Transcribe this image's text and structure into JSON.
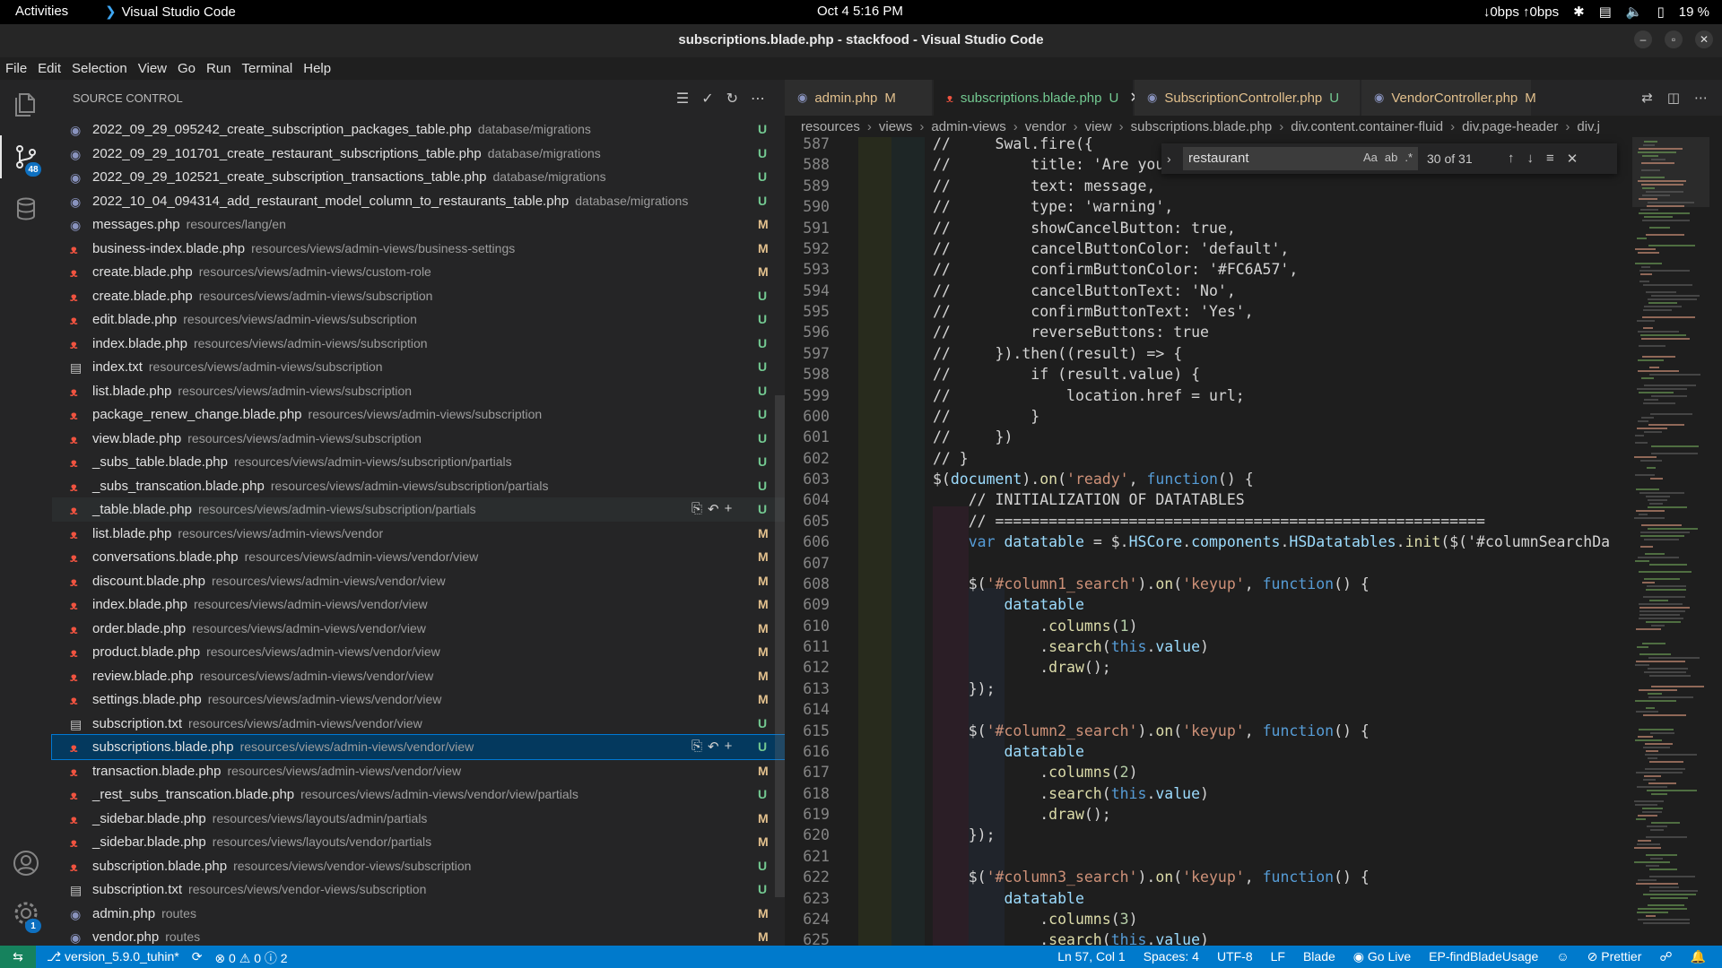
{
  "topbar": {
    "activities": "Activities",
    "app_name": "Visual Studio Code",
    "clock": "Oct 4  5:16 PM",
    "network": "↓0bps ↑0bps",
    "battery": "19 %"
  },
  "window": {
    "title": "subscriptions.blade.php - stackfood - Visual Studio Code"
  },
  "menu": [
    "File",
    "Edit",
    "Selection",
    "View",
    "Go",
    "Run",
    "Terminal",
    "Help"
  ],
  "activity": {
    "source_control_badge": "48",
    "settings_badge": "1"
  },
  "sidebar": {
    "title": "SOURCE CONTROL",
    "files": [
      {
        "name": "2022_09_29_095242_create_subscription_packages_table.php",
        "path": "database/migrations",
        "status": "U",
        "icon": "php"
      },
      {
        "name": "2022_09_29_101701_create_restaurant_subscriptions_table.php",
        "path": "database/migrations",
        "status": "U",
        "icon": "php"
      },
      {
        "name": "2022_09_29_102521_create_subscription_transactions_table.php",
        "path": "database/migrations",
        "status": "U",
        "icon": "php"
      },
      {
        "name": "2022_10_04_094314_add_restaurant_model_column_to_restaurants_table.php",
        "path": "database/migrations",
        "status": "U",
        "icon": "php"
      },
      {
        "name": "messages.php",
        "path": "resources/lang/en",
        "status": "M",
        "icon": "php"
      },
      {
        "name": "business-index.blade.php",
        "path": "resources/views/admin-views/business-settings",
        "status": "M",
        "icon": "blade"
      },
      {
        "name": "create.blade.php",
        "path": "resources/views/admin-views/custom-role",
        "status": "M",
        "icon": "blade"
      },
      {
        "name": "create.blade.php",
        "path": "resources/views/admin-views/subscription",
        "status": "U",
        "icon": "blade"
      },
      {
        "name": "edit.blade.php",
        "path": "resources/views/admin-views/subscription",
        "status": "U",
        "icon": "blade"
      },
      {
        "name": "index.blade.php",
        "path": "resources/views/admin-views/subscription",
        "status": "U",
        "icon": "blade"
      },
      {
        "name": "index.txt",
        "path": "resources/views/admin-views/subscription",
        "status": "U",
        "icon": "txt"
      },
      {
        "name": "list.blade.php",
        "path": "resources/views/admin-views/subscription",
        "status": "U",
        "icon": "blade"
      },
      {
        "name": "package_renew_change.blade.php",
        "path": "resources/views/admin-views/subscription",
        "status": "U",
        "icon": "blade"
      },
      {
        "name": "view.blade.php",
        "path": "resources/views/admin-views/subscription",
        "status": "U",
        "icon": "blade"
      },
      {
        "name": "_subs_table.blade.php",
        "path": "resources/views/admin-views/subscription/partials",
        "status": "U",
        "icon": "blade"
      },
      {
        "name": "_subs_transcation.blade.php",
        "path": "resources/views/admin-views/subscription/partials",
        "status": "U",
        "icon": "blade"
      },
      {
        "name": "_table.blade.php",
        "path": "resources/views/admin-views/subscription/partials",
        "status": "U",
        "icon": "blade",
        "hover": true
      },
      {
        "name": "list.blade.php",
        "path": "resources/views/admin-views/vendor",
        "status": "M",
        "icon": "blade"
      },
      {
        "name": "conversations.blade.php",
        "path": "resources/views/admin-views/vendor/view",
        "status": "M",
        "icon": "blade"
      },
      {
        "name": "discount.blade.php",
        "path": "resources/views/admin-views/vendor/view",
        "status": "M",
        "icon": "blade"
      },
      {
        "name": "index.blade.php",
        "path": "resources/views/admin-views/vendor/view",
        "status": "M",
        "icon": "blade"
      },
      {
        "name": "order.blade.php",
        "path": "resources/views/admin-views/vendor/view",
        "status": "M",
        "icon": "blade"
      },
      {
        "name": "product.blade.php",
        "path": "resources/views/admin-views/vendor/view",
        "status": "M",
        "icon": "blade"
      },
      {
        "name": "review.blade.php",
        "path": "resources/views/admin-views/vendor/view",
        "status": "M",
        "icon": "blade"
      },
      {
        "name": "settings.blade.php",
        "path": "resources/views/admin-views/vendor/view",
        "status": "M",
        "icon": "blade"
      },
      {
        "name": "subscription.txt",
        "path": "resources/views/admin-views/vendor/view",
        "status": "U",
        "icon": "txt"
      },
      {
        "name": "subscriptions.blade.php",
        "path": "resources/views/admin-views/vendor/view",
        "status": "U",
        "icon": "blade",
        "selected": true
      },
      {
        "name": "transaction.blade.php",
        "path": "resources/views/admin-views/vendor/view",
        "status": "M",
        "icon": "blade"
      },
      {
        "name": "_rest_subs_transcation.blade.php",
        "path": "resources/views/admin-views/vendor/view/partials",
        "status": "U",
        "icon": "blade"
      },
      {
        "name": "_sidebar.blade.php",
        "path": "resources/views/layouts/admin/partials",
        "status": "M",
        "icon": "blade"
      },
      {
        "name": "_sidebar.blade.php",
        "path": "resources/views/layouts/vendor/partials",
        "status": "M",
        "icon": "blade"
      },
      {
        "name": "subscription.blade.php",
        "path": "resources/views/vendor-views/subscription",
        "status": "U",
        "icon": "blade"
      },
      {
        "name": "subscription.txt",
        "path": "resources/views/vendor-views/subscription",
        "status": "U",
        "icon": "txt"
      },
      {
        "name": "admin.php",
        "path": "routes",
        "status": "M",
        "icon": "php"
      },
      {
        "name": "vendor.php",
        "path": "routes",
        "status": "M",
        "icon": "php"
      }
    ]
  },
  "tabs": [
    {
      "label": "admin.php",
      "status": "M",
      "icon": "php",
      "active": false
    },
    {
      "label": "subscriptions.blade.php",
      "status": "U",
      "icon": "blade",
      "active": true
    },
    {
      "label": "SubscriptionController.php",
      "status": "U",
      "icon": "php",
      "active": false
    },
    {
      "label": "VendorController.php",
      "status": "M",
      "icon": "php",
      "active": false
    }
  ],
  "breadcrumb": [
    "resources",
    "views",
    "admin-views",
    "vendor",
    "view",
    "subscriptions.blade.php",
    "div.content.container-fluid",
    "div.page-header",
    "div.j"
  ],
  "find": {
    "query": "restaurant",
    "count": "30 of 31"
  },
  "code": [
    {
      "n": "587",
      "t": "//     Swal.fire({",
      "c": "com"
    },
    {
      "n": "588",
      "t": "//         title: 'Are you sure?',",
      "c": "com"
    },
    {
      "n": "589",
      "t": "//         text: message,",
      "c": "com"
    },
    {
      "n": "590",
      "t": "//         type: 'warning',",
      "c": "com"
    },
    {
      "n": "591",
      "t": "//         showCancelButton: true,",
      "c": "com"
    },
    {
      "n": "592",
      "t": "//         cancelButtonColor: 'default',",
      "c": "com"
    },
    {
      "n": "593",
      "t": "//         confirmButtonColor: '#FC6A57',",
      "c": "com"
    },
    {
      "n": "594",
      "t": "//         cancelButtonText: 'No',",
      "c": "com"
    },
    {
      "n": "595",
      "t": "//         confirmButtonText: 'Yes',",
      "c": "com"
    },
    {
      "n": "596",
      "t": "//         reverseButtons: true",
      "c": "com"
    },
    {
      "n": "597",
      "t": "//     }).then((result) => {",
      "c": "com"
    },
    {
      "n": "598",
      "t": "//         if (result.value) {",
      "c": "com"
    },
    {
      "n": "599",
      "t": "//             location.href = url;",
      "c": "com"
    },
    {
      "n": "600",
      "t": "//         }",
      "c": "com"
    },
    {
      "n": "601",
      "t": "//     })",
      "c": "com"
    },
    {
      "n": "602",
      "t": "// }",
      "c": "com"
    },
    {
      "n": "603",
      "t": "$(document).on('ready', function() {",
      "c": "code"
    },
    {
      "n": "604",
      "t": "    // INITIALIZATION OF DATATABLES",
      "c": "com"
    },
    {
      "n": "605",
      "t": "    // =======================================================",
      "c": "com"
    },
    {
      "n": "606",
      "t": "    var datatable = $.HSCore.components.HSDatatables.init($('#columnSearchDa",
      "c": "code"
    },
    {
      "n": "607",
      "t": "",
      "c": "code"
    },
    {
      "n": "608",
      "t": "    $('#column1_search').on('keyup', function() {",
      "c": "code"
    },
    {
      "n": "609",
      "t": "        datatable",
      "c": "code"
    },
    {
      "n": "610",
      "t": "            .columns(1)",
      "c": "code"
    },
    {
      "n": "611",
      "t": "            .search(this.value)",
      "c": "code"
    },
    {
      "n": "612",
      "t": "            .draw();",
      "c": "code"
    },
    {
      "n": "613",
      "t": "    });",
      "c": "code"
    },
    {
      "n": "614",
      "t": "",
      "c": "code"
    },
    {
      "n": "615",
      "t": "    $('#column2_search').on('keyup', function() {",
      "c": "code"
    },
    {
      "n": "616",
      "t": "        datatable",
      "c": "code"
    },
    {
      "n": "617",
      "t": "            .columns(2)",
      "c": "code"
    },
    {
      "n": "618",
      "t": "            .search(this.value)",
      "c": "code"
    },
    {
      "n": "619",
      "t": "            .draw();",
      "c": "code"
    },
    {
      "n": "620",
      "t": "    });",
      "c": "code"
    },
    {
      "n": "621",
      "t": "",
      "c": "code"
    },
    {
      "n": "622",
      "t": "    $('#column3_search').on('keyup', function() {",
      "c": "code"
    },
    {
      "n": "623",
      "t": "        datatable",
      "c": "code"
    },
    {
      "n": "624",
      "t": "            .columns(3)",
      "c": "code"
    },
    {
      "n": "625",
      "t": "            .search(this.value)",
      "c": "code"
    }
  ],
  "status": {
    "branch": "version_5.9.0_tuhin*",
    "errors": "0",
    "warnings": "0",
    "info": "2",
    "position": "Ln 57, Col 1",
    "spaces": "Spaces: 4",
    "encoding": "UTF-8",
    "eol": "LF",
    "language": "Blade",
    "go_live": "Go Live",
    "extension": "EP-findBladeUsage",
    "prettier": "Prettier"
  },
  "colors": {
    "statusbar": "#007acc",
    "untracked": "#73c991",
    "modified": "#e2c08d",
    "comment": "#6a9955"
  }
}
